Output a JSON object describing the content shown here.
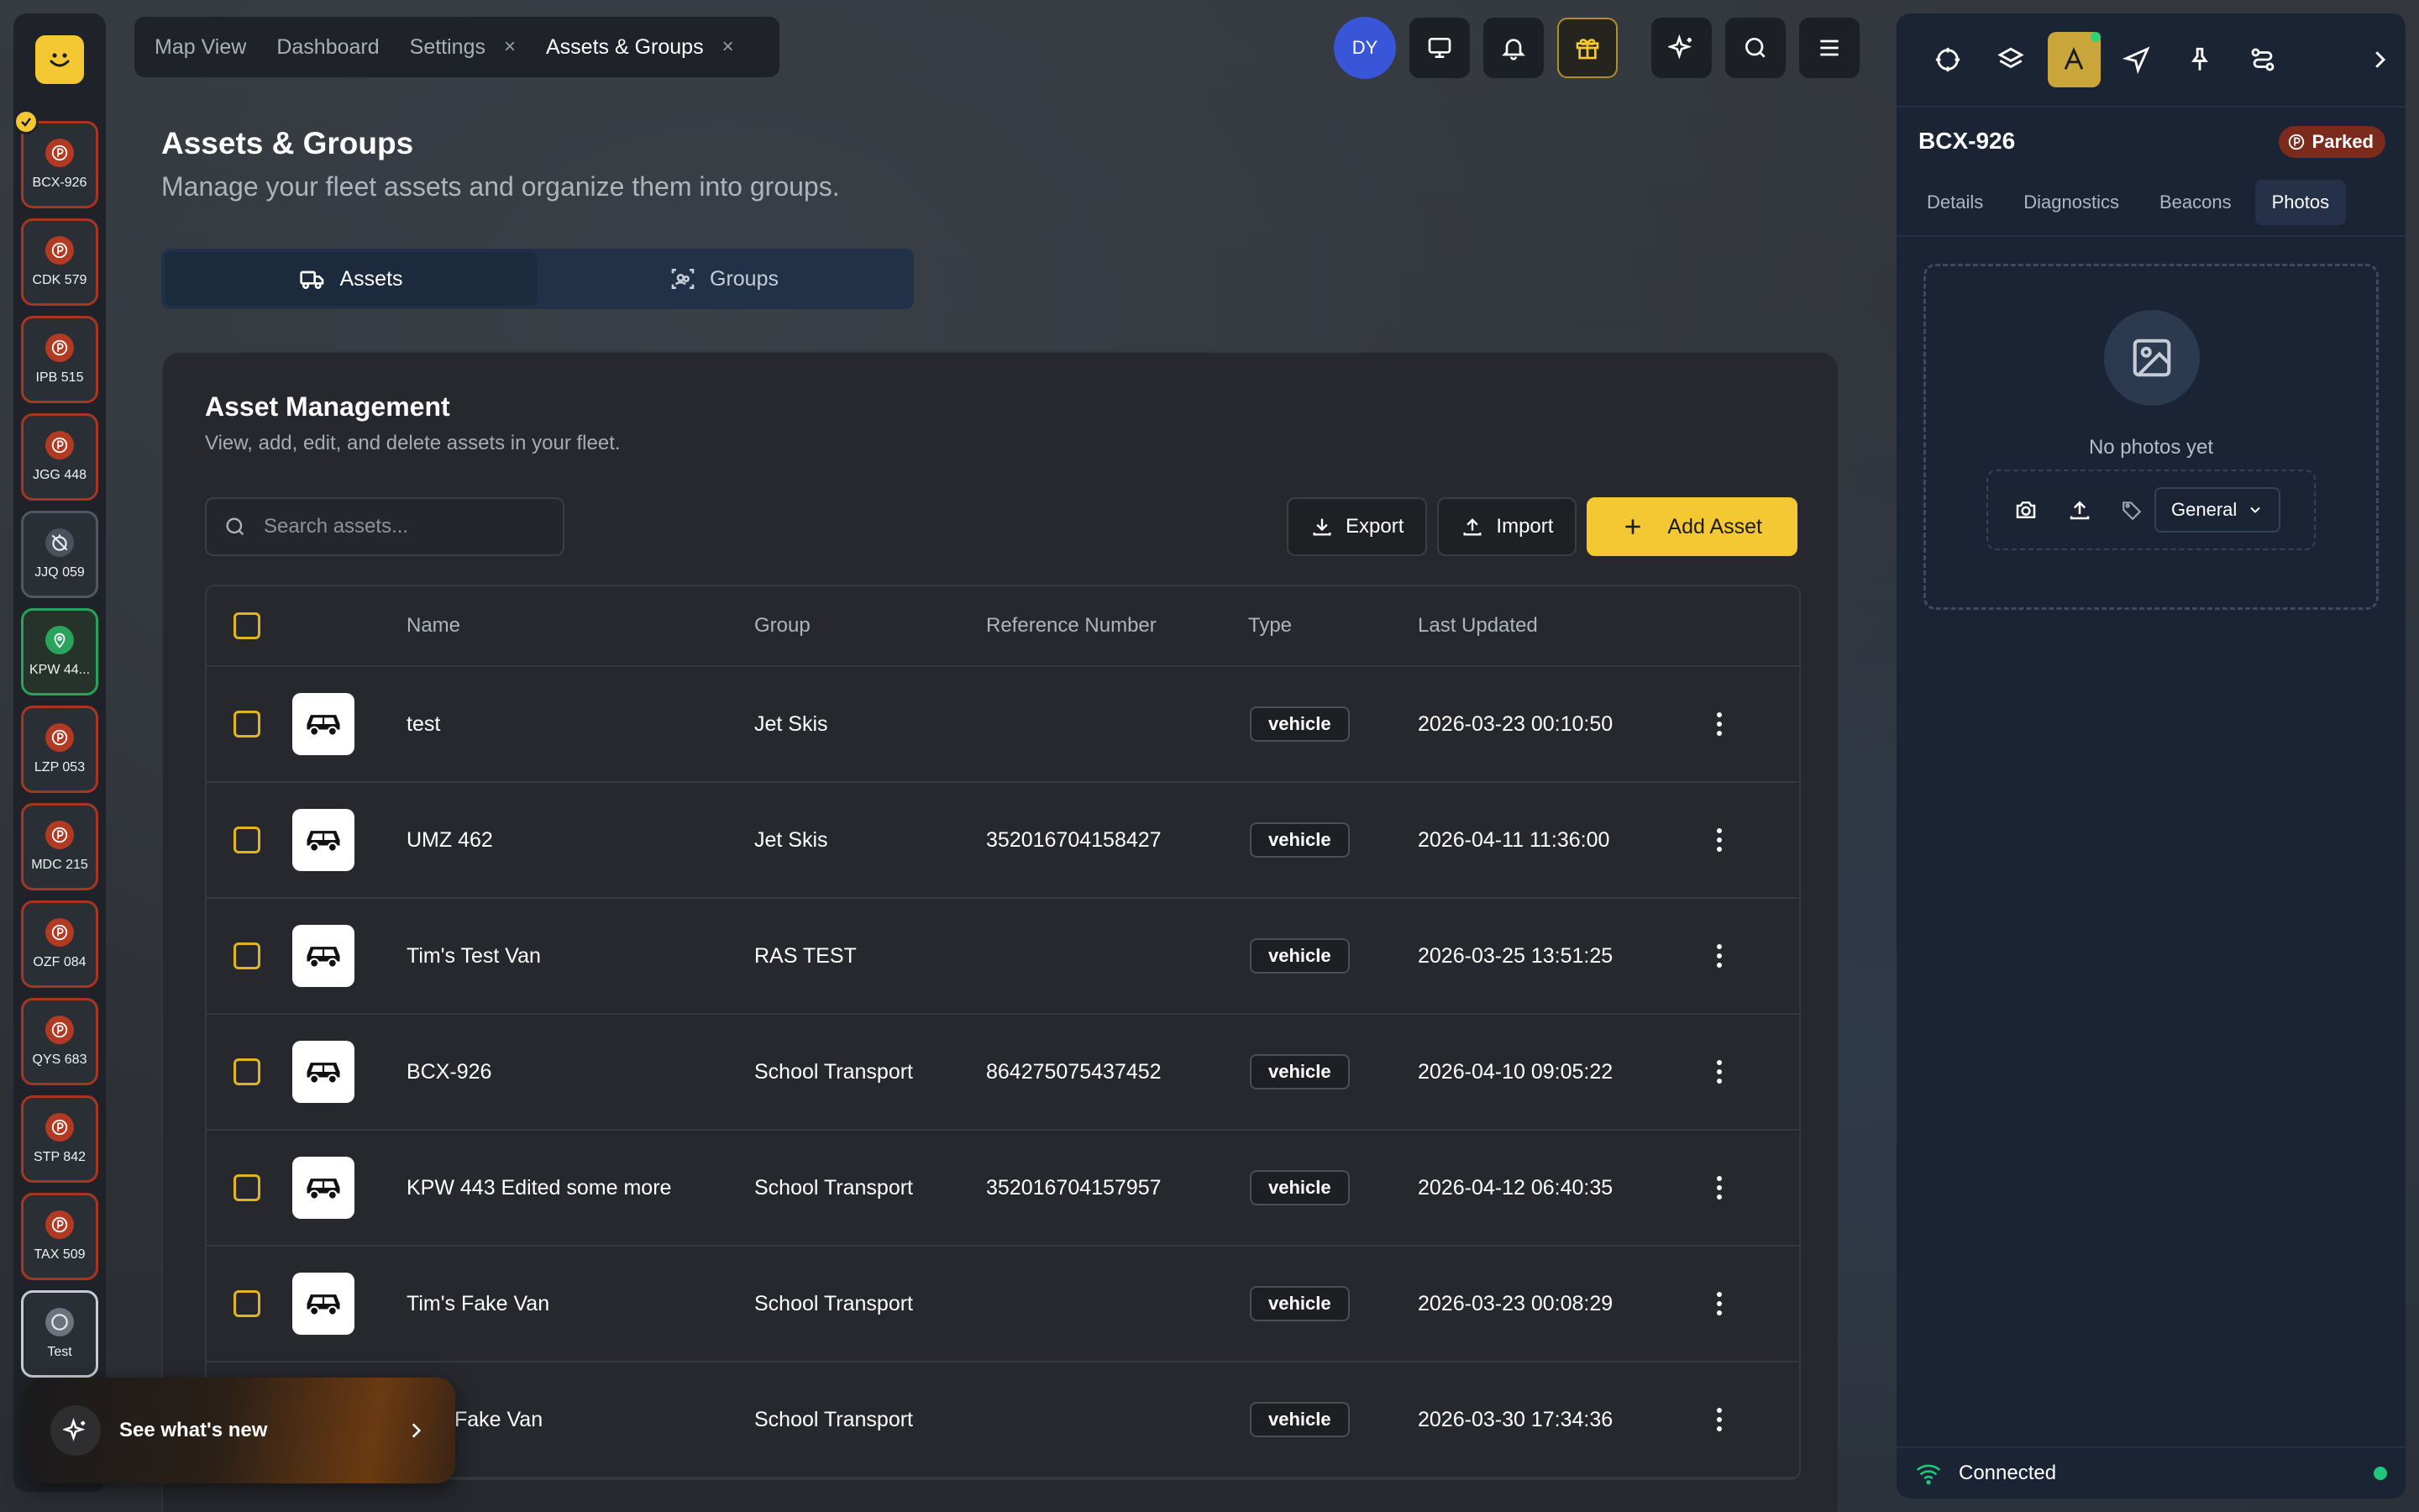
{
  "rail": {
    "assets": [
      {
        "label": "BCX-926",
        "status": "parked"
      },
      {
        "label": "CDK 579",
        "status": "parked"
      },
      {
        "label": "IPB 515",
        "status": "parked"
      },
      {
        "label": "JGG 448",
        "status": "parked"
      },
      {
        "label": "JJQ 059",
        "status": "offline"
      },
      {
        "label": "KPW 44...",
        "status": "moving"
      },
      {
        "label": "LZP 053",
        "status": "parked"
      },
      {
        "label": "MDC 215",
        "status": "parked"
      },
      {
        "label": "OZF 084",
        "status": "parked"
      },
      {
        "label": "QYS 683",
        "status": "parked"
      },
      {
        "label": "STP 842",
        "status": "parked"
      },
      {
        "label": "TAX 509",
        "status": "parked"
      },
      {
        "label": "Test",
        "status": "unknown"
      }
    ]
  },
  "tabs": [
    {
      "label": "Map View",
      "closable": false
    },
    {
      "label": "Dashboard",
      "closable": false
    },
    {
      "label": "Settings",
      "closable": true
    },
    {
      "label": "Assets & Groups",
      "closable": true,
      "active": true
    }
  ],
  "tab_close_glyph": "×",
  "topbar": {
    "avatar": "DY",
    "icons": [
      "monitor-icon",
      "bell-icon",
      "gift-icon",
      "sparkles-icon",
      "search-icon",
      "menu-icon"
    ]
  },
  "page": {
    "title": "Assets & Groups",
    "subtitle": "Manage your fleet assets and organize them into groups."
  },
  "segments": {
    "assets": "Assets",
    "groups": "Groups"
  },
  "card": {
    "title": "Asset Management",
    "subtitle": "View, add, edit, and delete assets in your fleet.",
    "search_placeholder": "Search assets...",
    "export": "Export",
    "import": "Import",
    "add": "Add Asset"
  },
  "table": {
    "headers": {
      "name": "Name",
      "group": "Group",
      "reference": "Reference Number",
      "type": "Type",
      "updated": "Last Updated"
    },
    "rows": [
      {
        "name": "test",
        "group": "Jet Skis",
        "reference": "",
        "type": "vehicle",
        "updated": "2026-03-23 00:10:50"
      },
      {
        "name": "UMZ 462",
        "group": "Jet Skis",
        "reference": "352016704158427",
        "type": "vehicle",
        "updated": "2026-04-11 11:36:00"
      },
      {
        "name": "Tim's Test Van",
        "group": "RAS TEST",
        "reference": "",
        "type": "vehicle",
        "updated": "2026-03-25 13:51:25"
      },
      {
        "name": "BCX-926",
        "group": "School Transport",
        "reference": "864275075437452",
        "type": "vehicle",
        "updated": "2026-04-10 09:05:22"
      },
      {
        "name": "KPW 443 Edited some more",
        "group": "School Transport",
        "reference": "352016704157957",
        "type": "vehicle",
        "updated": "2026-04-12 06:40:35"
      },
      {
        "name": "Tim's Fake Van",
        "group": "School Transport",
        "reference": "",
        "type": "vehicle",
        "updated": "2026-03-23 00:08:29"
      },
      {
        "name": "New Fake Van",
        "group": "School Transport",
        "reference": "",
        "type": "vehicle",
        "updated": "2026-03-30 17:34:36"
      }
    ]
  },
  "panel": {
    "asset": "BCX-926",
    "status": "Parked",
    "tabs": [
      "Details",
      "Diagnostics",
      "Beacons",
      "Photos"
    ],
    "active_tab": "Photos",
    "empty": "No photos yet",
    "category": "General",
    "connection": "Connected"
  },
  "whats_new": "See what's new",
  "colors": {
    "accent": "#f3c832",
    "parked": "#b23a23",
    "moving": "#2aa35d",
    "connected": "#20c77a",
    "avatar": "#3a56d8"
  }
}
